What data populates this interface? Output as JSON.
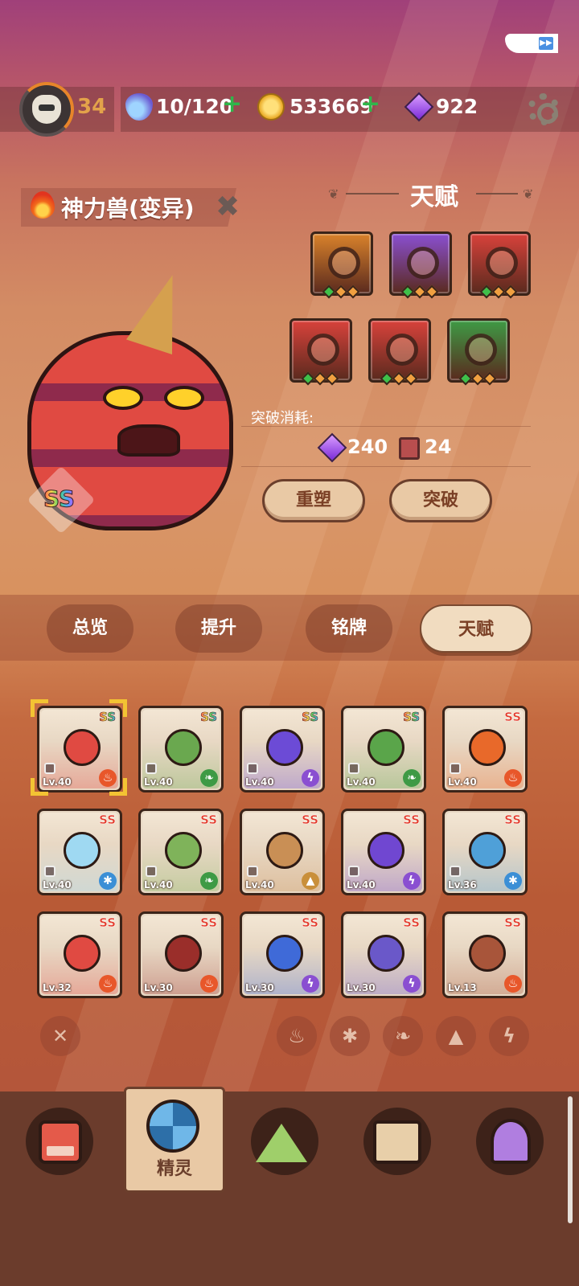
{
  "topbar": {
    "level": "34",
    "energy": "10/120",
    "coins": "533669",
    "gems": "922",
    "plus": "+"
  },
  "monster": {
    "name": "神力兽(变异)",
    "rank": "SS",
    "element_icon": "fire-icon"
  },
  "talent": {
    "title": "天赋",
    "cost_label": "突破消耗:",
    "cost_gems": "240",
    "cost_scrolls": "24",
    "reshape_label": "重塑",
    "breakthrough_label": "突破",
    "slots": [
      {
        "icon": "hexagon-crystal-icon",
        "color": "#d9822b"
      },
      {
        "icon": "slash-star-icon",
        "color": "#8a4fd1"
      },
      {
        "icon": "claw-arc-icon",
        "color": "#d8423b"
      },
      {
        "icon": "fang-jaw-icon",
        "color": "#d8423b"
      },
      {
        "icon": "claw-arc-icon",
        "color": "#d8423b"
      },
      {
        "icon": "leaf-slash-icon",
        "color": "#3e9a45"
      }
    ]
  },
  "tabs": [
    "总览",
    "提升",
    "铭牌",
    "天赋"
  ],
  "sprites": [
    {
      "rank": "SS",
      "level": "Lv.40",
      "element": "fire-icon",
      "color": "#e04a42"
    },
    {
      "rank": "SS",
      "level": "Lv.40",
      "element": "leaf-icon",
      "color": "#6aa84f"
    },
    {
      "rank": "SS",
      "level": "Lv.40",
      "element": "lightning-icon",
      "color": "#6c4bd6"
    },
    {
      "rank": "SS",
      "level": "Lv.40",
      "element": "leaf-icon",
      "color": "#5aa54a"
    },
    {
      "rank": "SS",
      "level": "Lv.40",
      "element": "fire-icon",
      "color": "#e8692a"
    },
    {
      "rank": "SS",
      "level": "Lv.40",
      "element": "snow-icon",
      "color": "#9fd9f2"
    },
    {
      "rank": "SS",
      "level": "Lv.40",
      "element": "leaf-icon",
      "color": "#7fb35a"
    },
    {
      "rank": "SS",
      "level": "Lv.40",
      "element": "earth-icon",
      "color": "#c98f55"
    },
    {
      "rank": "SS",
      "level": "Lv.40",
      "element": "lightning-icon",
      "color": "#7047d1"
    },
    {
      "rank": "SS",
      "level": "Lv.36",
      "element": "snow-icon",
      "color": "#4fa0d8"
    },
    {
      "rank": "SS",
      "level": "Lv.32",
      "element": "fire-icon",
      "color": "#e04a42"
    },
    {
      "rank": "SS",
      "level": "Lv.30",
      "element": "fire-icon",
      "color": "#9a2e2a"
    },
    {
      "rank": "SS",
      "level": "Lv.30",
      "element": "lightning-icon",
      "color": "#3f6ad8"
    },
    {
      "rank": "SS",
      "level": "Lv.30",
      "element": "lightning-icon",
      "color": "#6a58c9"
    },
    {
      "rank": "SS",
      "level": "Lv.13",
      "element": "fire-icon",
      "color": "#a8553a"
    }
  ],
  "filters": [
    "close-filter-icon",
    "fire-filter-icon",
    "snow-filter-icon",
    "leaf-filter-icon",
    "earth-filter-icon",
    "lightning-filter-icon"
  ],
  "bottom_nav": {
    "active_label": "精灵",
    "items": [
      "console-icon",
      "sprite-orb-icon",
      "mountain-icon",
      "chest-icon",
      "map-pin-icon"
    ]
  }
}
